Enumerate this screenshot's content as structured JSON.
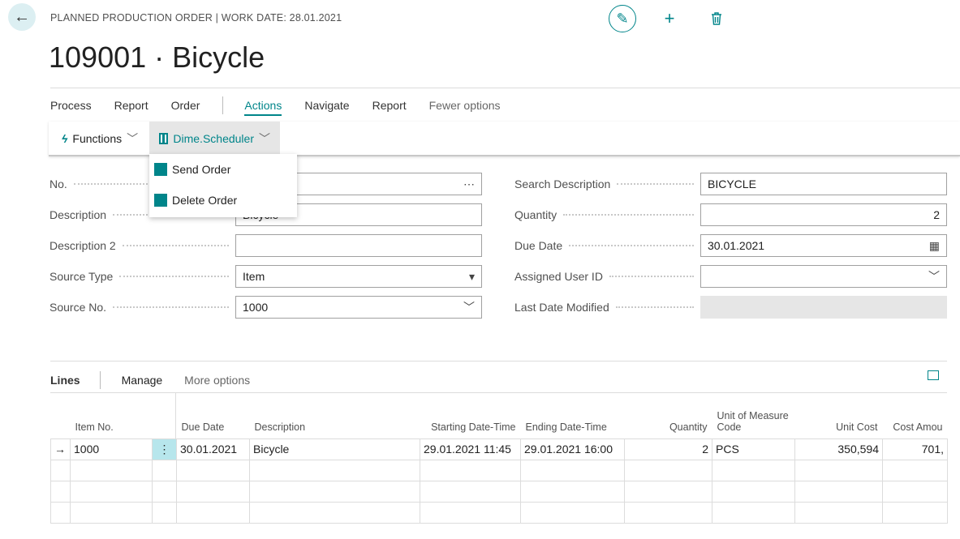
{
  "header": {
    "caption": "PLANNED PRODUCTION ORDER | WORK DATE: 28.01.2021",
    "title": "109001 · Bicycle"
  },
  "menu": {
    "items": [
      "Process",
      "Report",
      "Order"
    ],
    "active": "Actions",
    "items2": [
      "Navigate",
      "Report"
    ],
    "fewer": "Fewer options"
  },
  "actionbar": {
    "functions": "Functions",
    "dime": "Dime.Scheduler"
  },
  "dropdown": {
    "send": "Send Order",
    "delete": "Delete Order"
  },
  "fields": {
    "left": [
      {
        "label": "No.",
        "value": "",
        "icon": "ellipsis"
      },
      {
        "label": "Description",
        "value": "Bicycle"
      },
      {
        "label": "Description 2",
        "value": ""
      },
      {
        "label": "Source Type",
        "value": "Item",
        "icon": "select-arrow"
      },
      {
        "label": "Source No.",
        "value": "1000",
        "icon": "chevron-down"
      }
    ],
    "right": [
      {
        "label": "Search Description",
        "value": "BICYCLE"
      },
      {
        "label": "Quantity",
        "value": "2"
      },
      {
        "label": "Due Date",
        "value": "30.01.2021",
        "icon": "calendar"
      },
      {
        "label": "Assigned User ID",
        "value": "",
        "icon": "chevron-down"
      },
      {
        "label": "Last Date Modified",
        "value": "",
        "disabled": true
      }
    ]
  },
  "lines": {
    "title": "Lines",
    "manage": "Manage",
    "more": "More options",
    "columns": [
      "Item No.",
      "Due Date",
      "Description",
      "Starting Date-Time",
      "Ending Date-Time",
      "Quantity",
      "Unit of Measure Code",
      "Unit Cost",
      "Cost Amou"
    ],
    "rows": [
      [
        "1000",
        "30.01.2021",
        "Bicycle",
        "29.01.2021 11:45",
        "29.01.2021 16:00",
        "2",
        "PCS",
        "350,594",
        "701,"
      ]
    ]
  },
  "colors": {
    "accent": "#00858a",
    "selected_cell": "#b7e6ec"
  }
}
